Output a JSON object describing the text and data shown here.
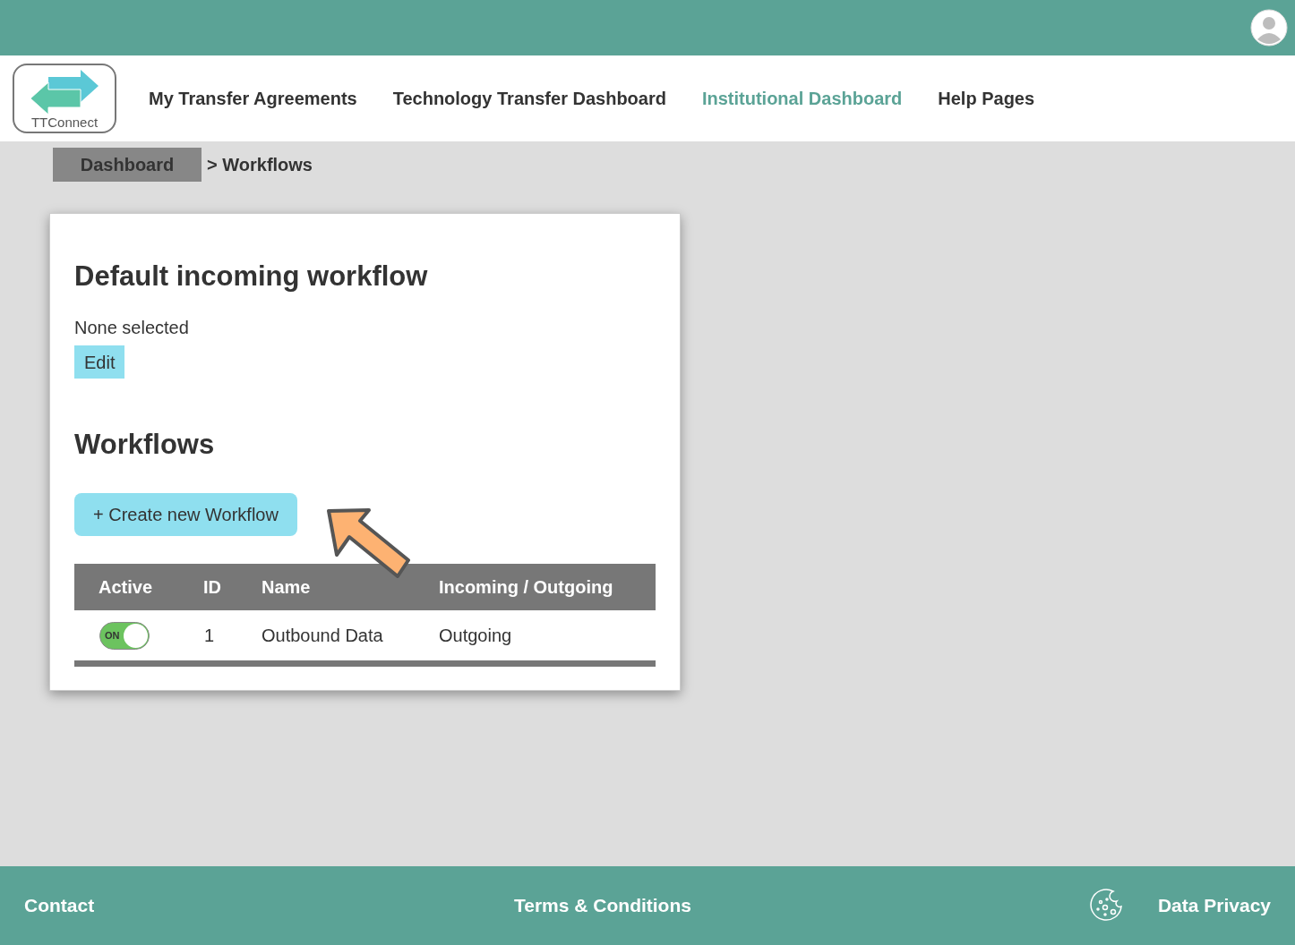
{
  "logo": {
    "text": "TTConnect"
  },
  "nav": [
    {
      "label": "My Transfer Agreements",
      "selected": false
    },
    {
      "label": "Technology Transfer Dashboard",
      "selected": false
    },
    {
      "label": "Institutional Dashboard",
      "selected": true
    },
    {
      "label": "Help Pages",
      "selected": false
    }
  ],
  "breadcrumb": {
    "link": "Dashboard",
    "current": "> Workflows"
  },
  "default_workflow": {
    "heading": "Default incoming workflow",
    "value": "None selected",
    "button": "Edit"
  },
  "workflows": {
    "heading": "Workflows",
    "create_button": "+ Create new Workflow",
    "columns": [
      "Active",
      "ID",
      "Name",
      "Incoming / Outgoing"
    ],
    "rows": [
      {
        "active": true,
        "toggle_label": "ON",
        "id": "1",
        "name": "Outbound Data",
        "direction": "Outgoing"
      }
    ]
  },
  "footer": {
    "contact": "Contact",
    "terms": "Terms & Conditions",
    "privacy": "Data Privacy"
  }
}
